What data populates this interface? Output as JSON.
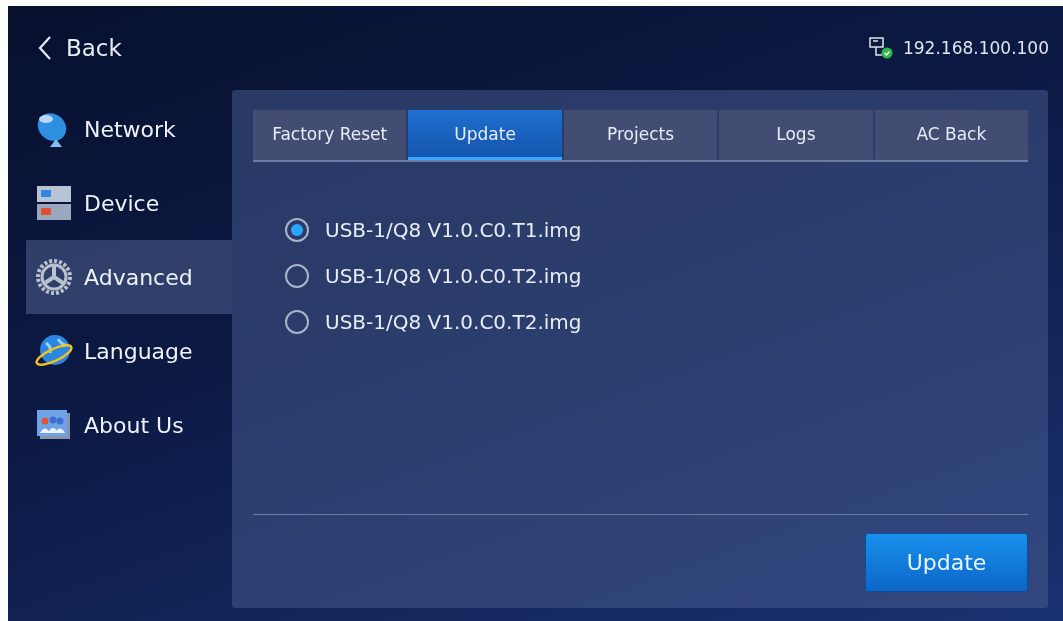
{
  "header": {
    "back": "Back",
    "ip": "192.168.100.100"
  },
  "sidebar": {
    "items": [
      {
        "label": "Network",
        "kind": "network",
        "selected": false
      },
      {
        "label": "Device",
        "kind": "device",
        "selected": false
      },
      {
        "label": "Advanced",
        "kind": "advanced",
        "selected": true
      },
      {
        "label": "Language",
        "kind": "language",
        "selected": false
      },
      {
        "label": "About Us",
        "kind": "about",
        "selected": false
      }
    ]
  },
  "tabs": [
    {
      "label": "Factory Reset",
      "selected": false
    },
    {
      "label": "Update",
      "selected": true
    },
    {
      "label": "Projects",
      "selected": false
    },
    {
      "label": "Logs",
      "selected": false
    },
    {
      "label": "AC Back",
      "selected": false
    }
  ],
  "files": [
    {
      "label": "USB-1/Q8 V1.0.C0.T1.img",
      "selected": true
    },
    {
      "label": "USB-1/Q8 V1.0.C0.T2.img",
      "selected": false
    },
    {
      "label": "USB-1/Q8 V1.0.C0.T2.img",
      "selected": false
    }
  ],
  "button": "Update"
}
